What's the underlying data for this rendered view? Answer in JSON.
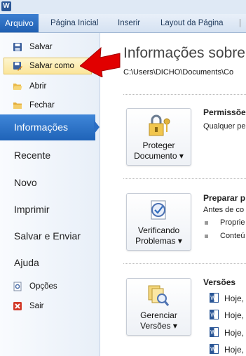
{
  "ribbon": {
    "app_icon_letter": "W",
    "file_tab": "Arquivo",
    "tabs": [
      "Página Inicial",
      "Inserir",
      "Layout da Página"
    ]
  },
  "backstage": {
    "commands": [
      "Salvar",
      "Salvar como",
      "Abrir",
      "Fechar"
    ],
    "selected": "Informações",
    "nav": [
      "Recente",
      "Novo",
      "Imprimir",
      "Salvar e Enviar",
      "Ajuda"
    ],
    "bottom_commands": [
      "Opções",
      "Sair"
    ]
  },
  "info": {
    "title": "Informações sobre",
    "path": "C:\\Users\\DICHO\\Documents\\Co",
    "protect": {
      "line1": "Proteger",
      "line2": "Documento ▾",
      "heading": "Permissõe",
      "desc": "Qualquer pe"
    },
    "check": {
      "line1": "Verificando",
      "line2": "Problemas ▾",
      "heading": "Preparar p",
      "desc": "Antes de co",
      "items": [
        "Proprie",
        "Conteú"
      ]
    },
    "versions": {
      "line1": "Gerenciar",
      "line2": "Versões ▾",
      "heading": "Versões",
      "items": [
        "Hoje,",
        "Hoje,",
        "Hoje,",
        "Hoje,"
      ]
    }
  },
  "colors": {
    "accent": "#1f63b8",
    "arrow": "#e10000"
  }
}
